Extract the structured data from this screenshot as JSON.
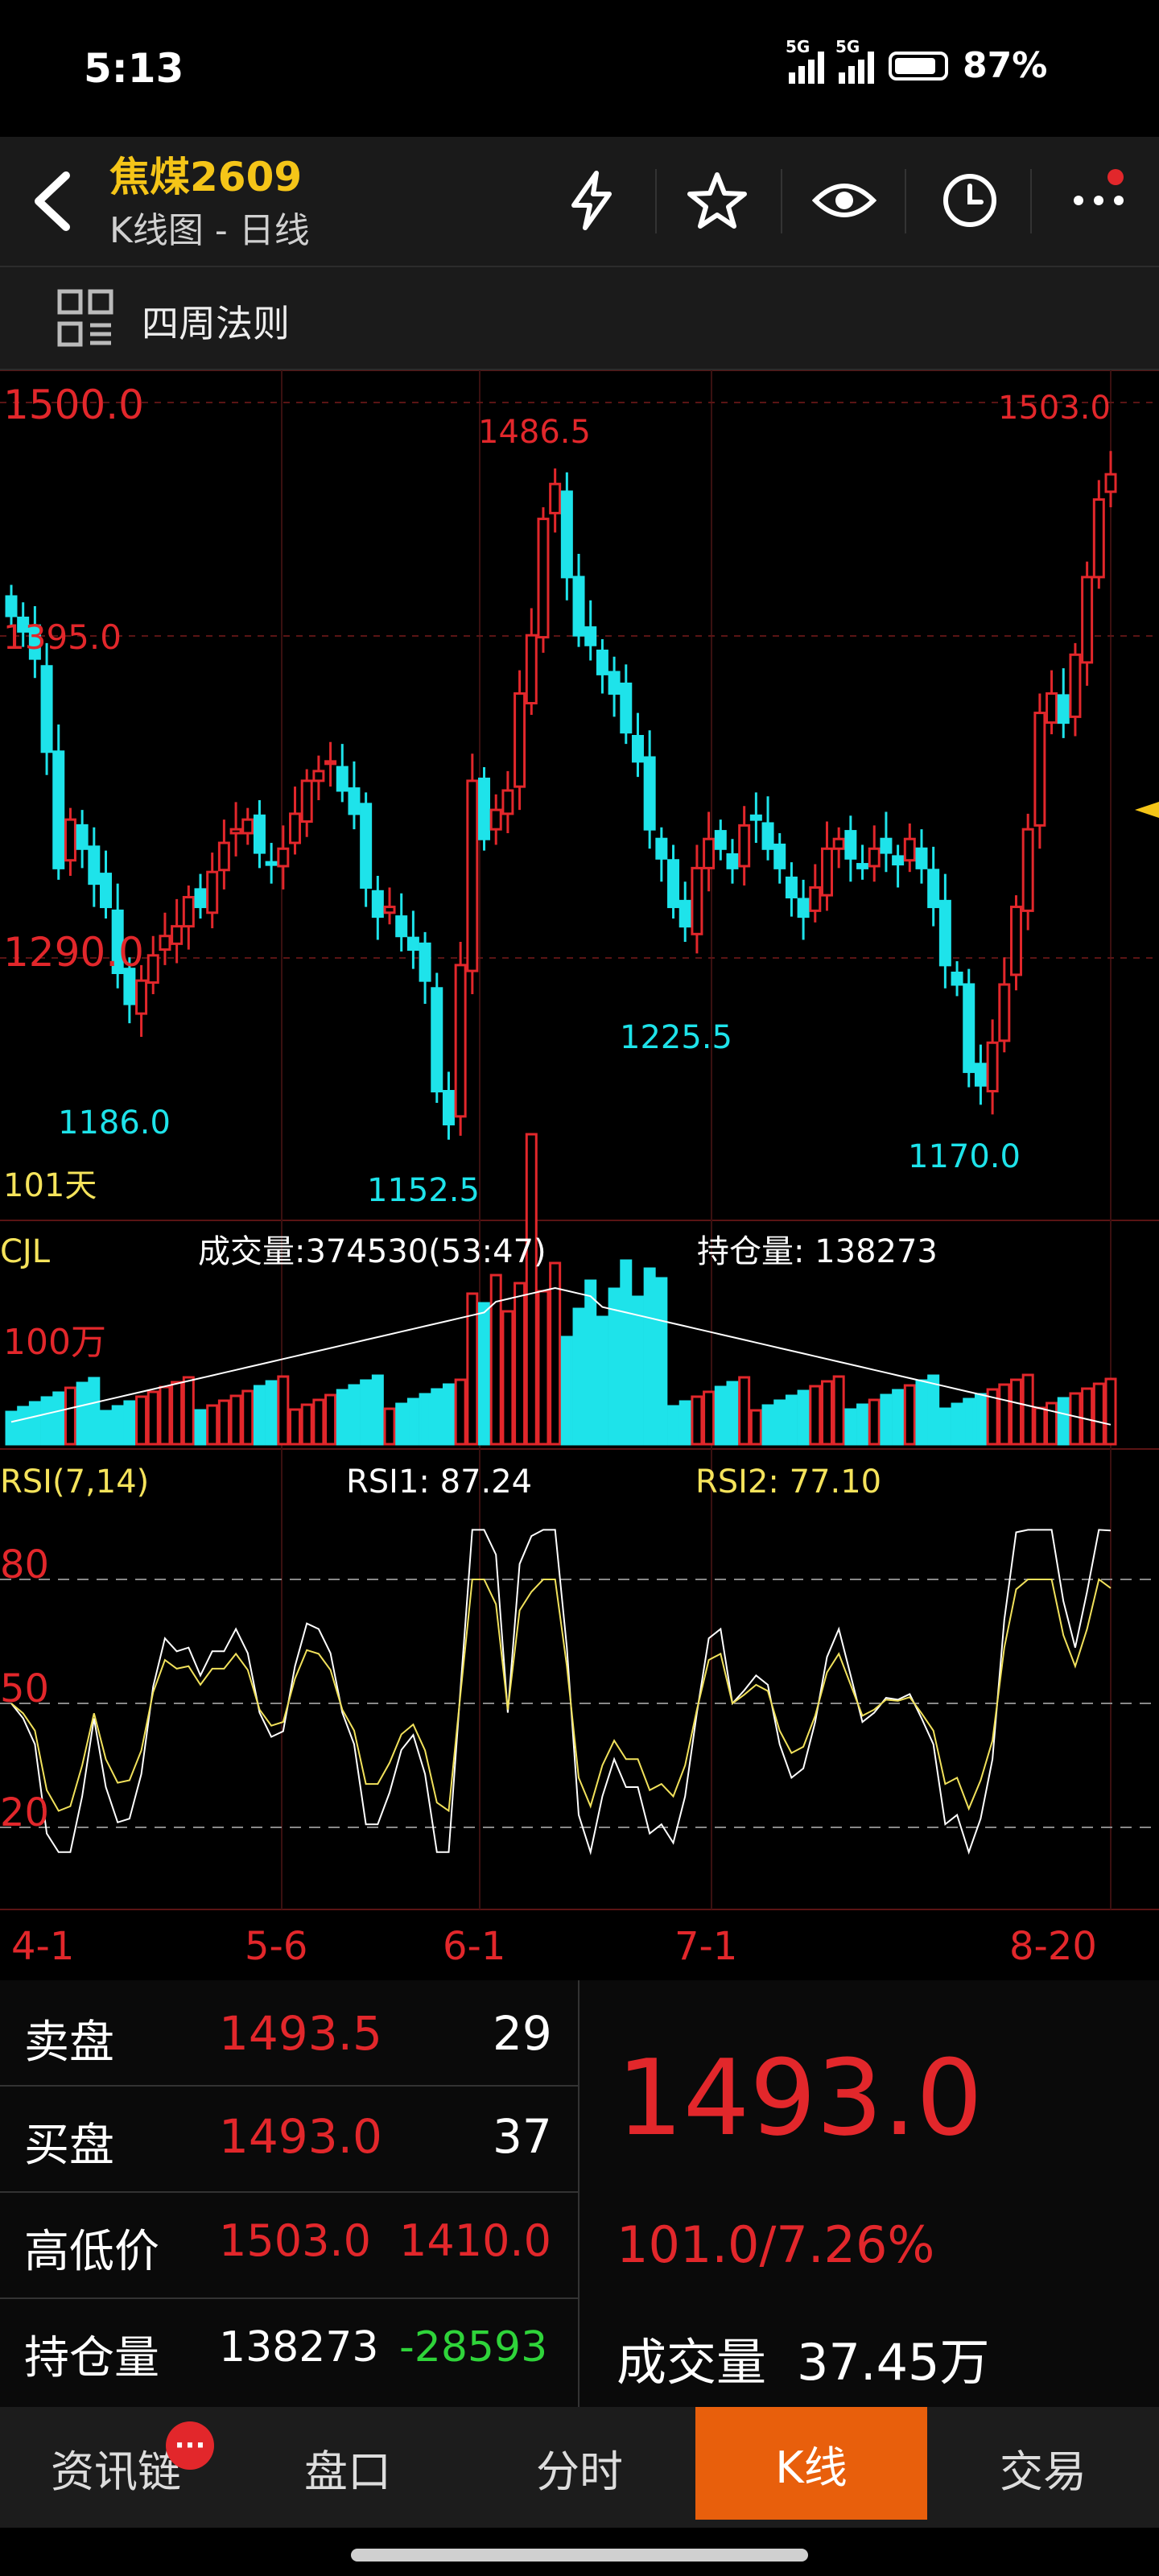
{
  "status": {
    "time": "5:13",
    "net1": "5G",
    "net2": "5G",
    "battery": "87%",
    "battery_level": 0.87
  },
  "header": {
    "title": "焦煤2609",
    "subtitle": "K线图 - 日线",
    "icons": [
      "back-icon",
      "lightning-icon",
      "star-icon",
      "eye-icon",
      "clock-icon",
      "more-icon"
    ]
  },
  "strategy": {
    "label": "四周法则",
    "icon": "grid-icon"
  },
  "kline": {
    "labels": {
      "top_left": "1500.0",
      "mid_left": "1395.0",
      "low_left": "1290.0",
      "high_marker": "1486.5",
      "right_high": "1503.0",
      "low1": "1186.0",
      "low2": "1152.5",
      "low3": "1225.5",
      "low4": "1170.0",
      "days": "101天"
    },
    "price_top": 1530,
    "price_bottom": 1125,
    "axis_color": "#e2272b",
    "up_color": "#e2272b",
    "down_color": "#1ee3ea"
  },
  "volume": {
    "title": "CJL",
    "turnover": "成交量:374530(53:47)",
    "open_interest": "持仓量: 138273",
    "scale_label": "100万"
  },
  "rsi": {
    "title": "RSI(7,14)",
    "rsi1": "RSI1: 87.24",
    "rsi2": "RSI2: 77.10",
    "levels": [
      "80",
      "50",
      "20"
    ],
    "rsi1_color": "#ffffff",
    "rsi2_color": "#f1e15b"
  },
  "x_axis": [
    "4-1",
    "5-6",
    "6-1",
    "7-1",
    "8-20"
  ],
  "chart_data": {
    "type": "candlestick",
    "ohlc_close": [
      1420,
      1412,
      1398,
      1350,
      1290,
      1315,
      1300,
      1282,
      1270,
      1236,
      1220,
      1232,
      1245,
      1255,
      1260,
      1275,
      1270,
      1288,
      1303,
      1310,
      1315,
      1298,
      1292,
      1300,
      1318,
      1335,
      1340,
      1345,
      1330,
      1318,
      1280,
      1265,
      1270,
      1255,
      1248,
      1232,
      1175,
      1158,
      1240,
      1335,
      1305,
      1320,
      1330,
      1380,
      1410,
      1470,
      1488,
      1440,
      1410,
      1405,
      1390,
      1380,
      1360,
      1345,
      1310,
      1295,
      1270,
      1260,
      1290,
      1305,
      1300,
      1290,
      1312,
      1315,
      1300,
      1290,
      1275,
      1265,
      1280,
      1300,
      1305,
      1295,
      1290,
      1300,
      1298,
      1292,
      1305,
      1290,
      1270,
      1240,
      1230,
      1185,
      1178,
      1200,
      1230,
      1270,
      1310,
      1370,
      1380,
      1365,
      1400,
      1440,
      1480,
      1493
    ],
    "rsi1_color_name": "white",
    "rsi2_color_name": "yellow"
  },
  "quote": {
    "ask_label": "卖盘",
    "ask_price": "1493.5",
    "ask_vol": "29",
    "bid_label": "买盘",
    "bid_price": "1493.0",
    "bid_vol": "37",
    "hl_label": "高低价",
    "high": "1503.0",
    "low": "1410.0",
    "oi_label": "持仓量",
    "oi_value": "138273",
    "oi_change": "-28593",
    "last": "1493.0",
    "change": "101.0/7.26%",
    "volume_label": "成交量",
    "volume_value": "37.45万"
  },
  "tabs": [
    {
      "label": "资讯链",
      "badge": "···"
    },
    {
      "label": "盘口"
    },
    {
      "label": "分时"
    },
    {
      "label": "K线"
    },
    {
      "label": "交易"
    }
  ]
}
